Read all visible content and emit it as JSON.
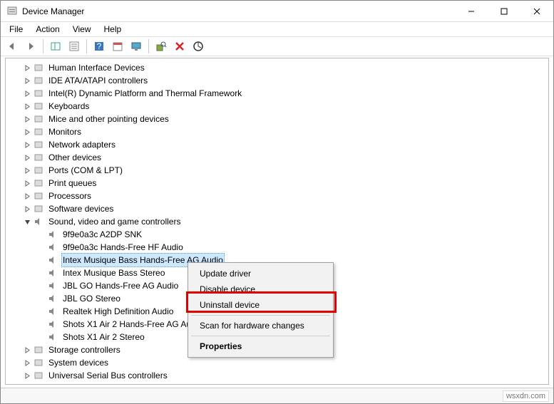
{
  "window": {
    "title": "Device Manager",
    "controls": {
      "min": "minimize",
      "max": "maximize",
      "close": "close"
    }
  },
  "menu": [
    "File",
    "Action",
    "View",
    "Help"
  ],
  "tree": {
    "categories": [
      {
        "label": "Human Interface Devices",
        "icon": "hid"
      },
      {
        "label": "IDE ATA/ATAPI controllers",
        "icon": "ide"
      },
      {
        "label": "Intel(R) Dynamic Platform and Thermal Framework",
        "icon": "chip"
      },
      {
        "label": "Keyboards",
        "icon": "keyboard"
      },
      {
        "label": "Mice and other pointing devices",
        "icon": "mouse"
      },
      {
        "label": "Monitors",
        "icon": "monitor"
      },
      {
        "label": "Network adapters",
        "icon": "network"
      },
      {
        "label": "Other devices",
        "icon": "other"
      },
      {
        "label": "Ports (COM & LPT)",
        "icon": "port"
      },
      {
        "label": "Print queues",
        "icon": "printer"
      },
      {
        "label": "Processors",
        "icon": "cpu"
      },
      {
        "label": "Software devices",
        "icon": "software"
      }
    ],
    "sound_category": {
      "label": "Sound, video and game controllers",
      "icon": "sound"
    },
    "sound_devices": [
      "9f9e0a3c A2DP SNK",
      "9f9e0a3c Hands-Free HF Audio",
      "Intex Musique Bass Hands-Free AG Audio",
      "Intex Musique Bass Stereo",
      "JBL GO Hands-Free AG Audio",
      "JBL GO Stereo",
      "Realtek High Definition Audio",
      "Shots X1 Air 2 Hands-Free AG Audio",
      "Shots X1 Air 2 Stereo"
    ],
    "selected_index": 2,
    "after": [
      {
        "label": "Storage controllers",
        "icon": "storage"
      },
      {
        "label": "System devices",
        "icon": "system"
      },
      {
        "label": "Universal Serial Bus controllers",
        "icon": "usb"
      }
    ]
  },
  "context_menu": {
    "items": [
      {
        "label": "Update driver"
      },
      {
        "label": "Disable device"
      },
      {
        "label": "Uninstall device",
        "highlighted": true
      },
      {
        "separator": true
      },
      {
        "label": "Scan for hardware changes"
      },
      {
        "separator": true
      },
      {
        "label": "Properties",
        "bold": true
      }
    ]
  },
  "watermark": "wsxdn.com"
}
